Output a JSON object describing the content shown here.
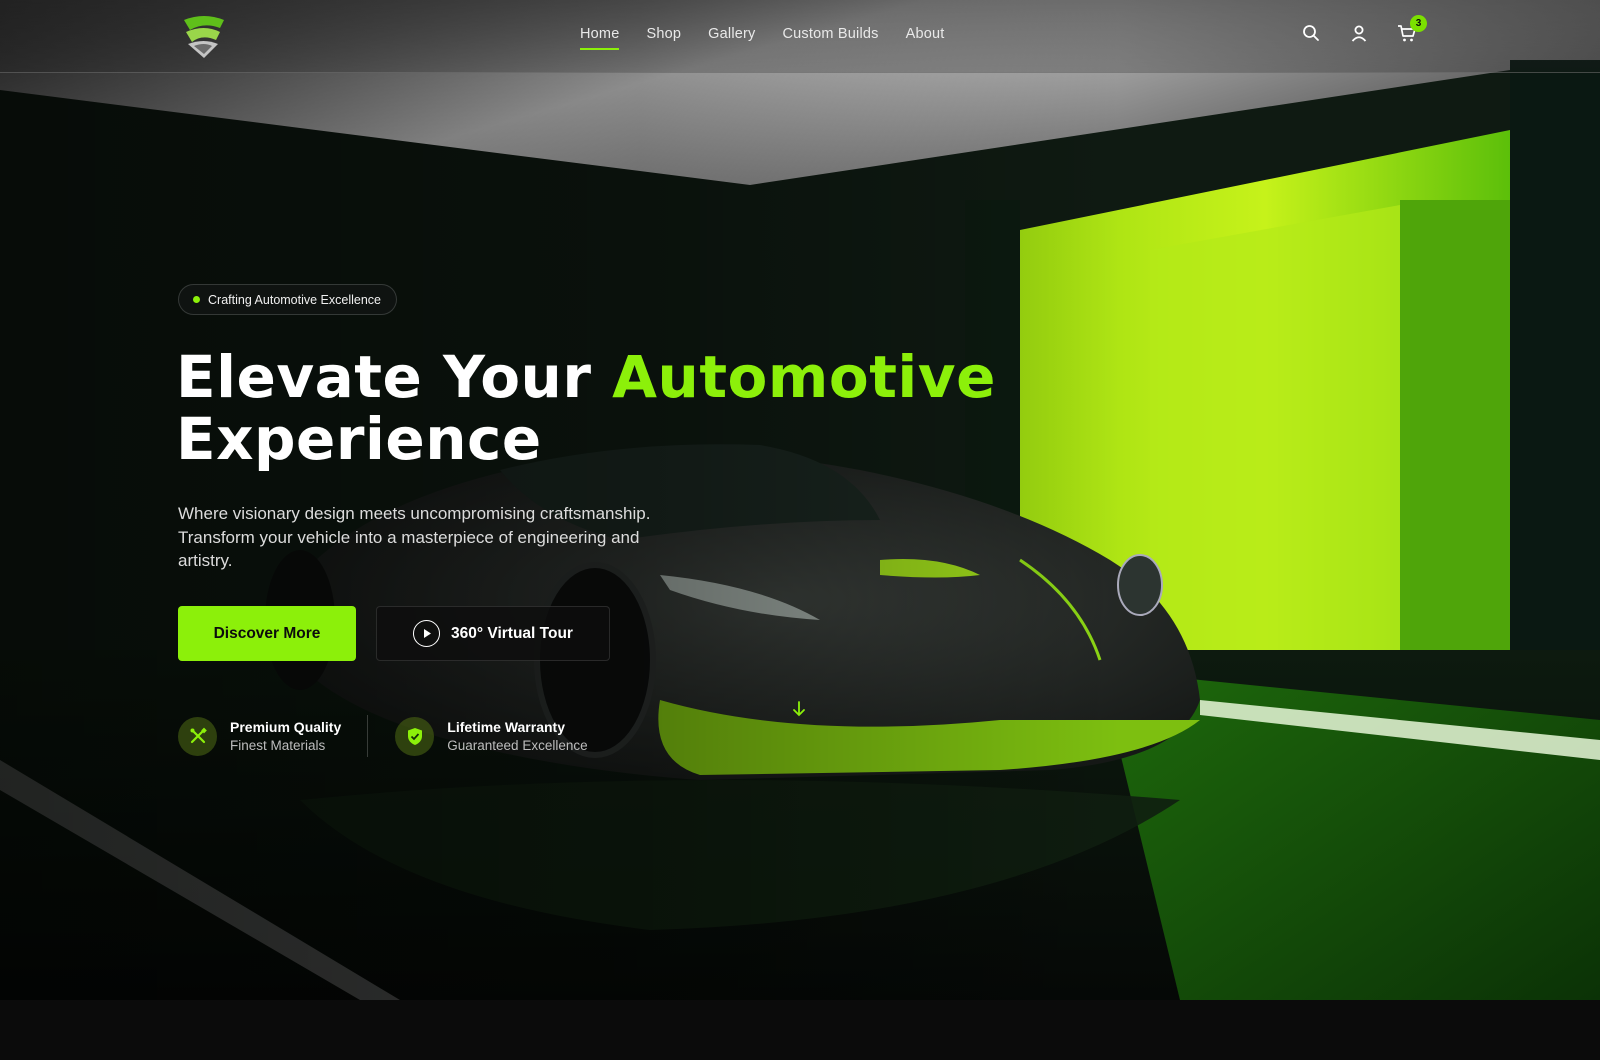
{
  "nav": {
    "items": [
      {
        "label": "Home",
        "active": true
      },
      {
        "label": "Shop",
        "active": false
      },
      {
        "label": "Gallery",
        "active": false
      },
      {
        "label": "Custom Builds",
        "active": false
      },
      {
        "label": "About",
        "active": false
      }
    ],
    "icons": [
      "search-icon",
      "user-icon",
      "cart-icon"
    ],
    "cart_count": "3"
  },
  "hero": {
    "badge": "Crafting Automotive Excellence",
    "headline_part1": "Elevate Your ",
    "headline_accent": "Automotive",
    "headline_part2": "Experience",
    "subtext": "Where visionary design meets uncompromising craftsmanship. Transform your vehicle into a masterpiece of engineering and artistry.",
    "primary_cta": "Discover More",
    "secondary_cta": "360° Virtual Tour",
    "features": [
      {
        "icon": "tools-icon",
        "title": "Premium Quality",
        "subtitle": "Finest Materials"
      },
      {
        "icon": "shield-check-icon",
        "title": "Lifetime Warranty",
        "subtitle": "Guaranteed Excellence"
      }
    ]
  },
  "colors": {
    "accent": "#8cf00a",
    "background": "#0b0b0b"
  }
}
